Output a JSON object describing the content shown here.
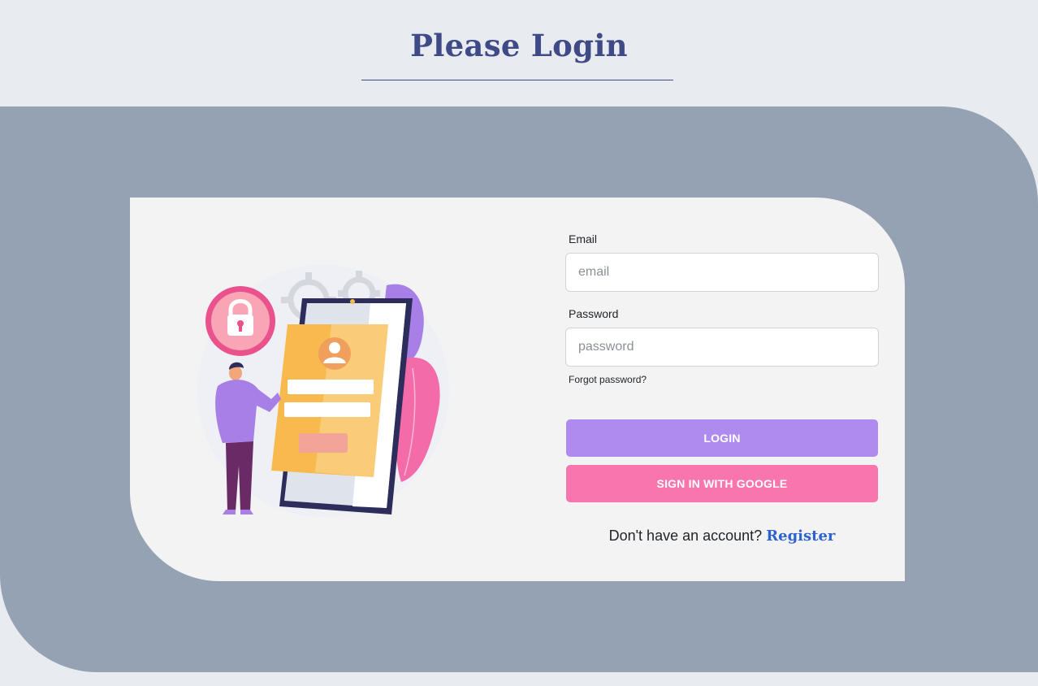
{
  "header": {
    "title": "Please Login"
  },
  "form": {
    "email": {
      "label": "Email",
      "placeholder": "email",
      "value": ""
    },
    "password": {
      "label": "Password",
      "placeholder": "password",
      "value": ""
    },
    "forgot_password": "Forgot password?",
    "login_button": "LOGIN",
    "google_button": "SIGN IN WITH GOOGLE",
    "register_prompt": "Don't have an account?",
    "register_link": "Register"
  },
  "illustration": {
    "icon": "login-illustration",
    "lock_icon": "padlock-icon"
  },
  "colors": {
    "title": "#3f4a87",
    "backdrop": "#95a2b3",
    "card": "#f3f3f4",
    "login_button": "#af8aef",
    "google_button": "#f876ad",
    "register_link": "#2f62d1"
  }
}
